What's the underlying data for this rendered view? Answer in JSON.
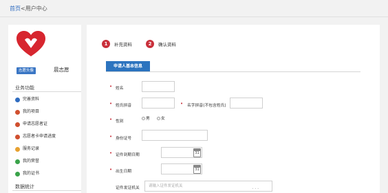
{
  "breadcrumb": {
    "home": "首页",
    "sep": "<",
    "current": "用户中心"
  },
  "sidebar": {
    "tag": "志愿头像",
    "name": "晨志愿",
    "section1": "业务功能",
    "items": [
      {
        "label": "完善资料",
        "color": "#2f6cc0"
      },
      {
        "label": "我的项目",
        "color": "#d0502f"
      },
      {
        "label": "申请志愿者证",
        "color": "#d0502f"
      },
      {
        "label": "志愿者卡申请进度",
        "color": "#d0502f"
      },
      {
        "label": "服务记录",
        "color": "#e7a131"
      },
      {
        "label": "我的荣誉",
        "color": "#3aa34a"
      },
      {
        "label": "我的证书",
        "color": "#3aa34a"
      }
    ],
    "section2": "数据统计"
  },
  "steps": [
    {
      "num": "1",
      "label": "补充资料"
    },
    {
      "num": "2",
      "label": "确认资料"
    }
  ],
  "apply_button": "申请人基本信息",
  "form": {
    "name_label": "姓名",
    "pinyin_label": "姓氏拼音",
    "given_pinyin_label": "名字拼音(不包含姓氏)",
    "gender_label": "性别",
    "gender_male": "男",
    "gender_female": "女",
    "id_label": "身份证号",
    "expiry_label": "证件到期日期",
    "birth_label": "出生日期",
    "issuer_label": "证件发证机关",
    "issuer_placeholder": "请输入证件发证机关",
    "cal_text": "31"
  },
  "watermark": "..."
}
